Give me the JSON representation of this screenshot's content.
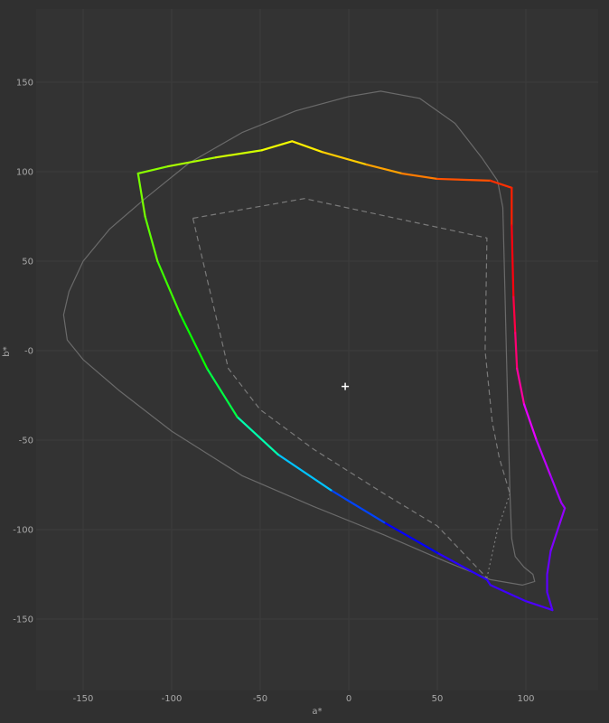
{
  "chart_data": {
    "type": "line",
    "title": "",
    "xlabel": "a*",
    "ylabel": "b*",
    "xlim": [
      -175,
      140
    ],
    "ylim": [
      -190,
      190
    ],
    "xticks": [
      -150,
      -100,
      -50,
      0,
      50,
      100
    ],
    "yticks": [
      150,
      100,
      50,
      0,
      -50,
      -100,
      -150
    ],
    "ytick_labels": [
      "150",
      "100",
      "50",
      "-0",
      "-50",
      "-100",
      "-150"
    ],
    "grid": true,
    "white_point": {
      "a": -2,
      "b": -20
    },
    "series": [
      {
        "style": "solid-gray",
        "closed": true,
        "points": [
          [
            -161,
            20
          ],
          [
            -158,
            33
          ],
          [
            -150,
            50
          ],
          [
            -135,
            68
          ],
          [
            -115,
            85
          ],
          [
            -90,
            105
          ],
          [
            -60,
            122
          ],
          [
            -30,
            134
          ],
          [
            0,
            142
          ],
          [
            18,
            145
          ],
          [
            40,
            141
          ],
          [
            60,
            127
          ],
          [
            75,
            108
          ],
          [
            84,
            95
          ],
          [
            87,
            80
          ],
          [
            88,
            40
          ],
          [
            89,
            0
          ],
          [
            90,
            -40
          ],
          [
            91,
            -80
          ],
          [
            92,
            -105
          ],
          [
            94,
            -115
          ],
          [
            99,
            -121
          ],
          [
            104,
            -125
          ],
          [
            105,
            -129
          ],
          [
            98,
            -131
          ],
          [
            80,
            -128
          ],
          [
            55,
            -118
          ],
          [
            20,
            -103
          ],
          [
            -20,
            -87
          ],
          [
            -60,
            -70
          ],
          [
            -100,
            -45
          ],
          [
            -130,
            -22
          ],
          [
            -150,
            -5
          ],
          [
            -159,
            6
          ]
        ]
      },
      {
        "style": "dashed-gray",
        "closed": false,
        "points": [
          [
            -88,
            74
          ],
          [
            -25,
            85
          ],
          [
            78,
            63
          ],
          [
            77,
            0
          ],
          [
            81,
            -40
          ],
          [
            85,
            -60
          ],
          [
            91,
            -80
          ]
        ]
      },
      {
        "style": "dashed-gray",
        "closed": false,
        "points": [
          [
            -88,
            74
          ],
          [
            -80,
            40
          ],
          [
            -68,
            -10
          ],
          [
            -50,
            -33
          ],
          [
            -20,
            -55
          ],
          [
            20,
            -80
          ],
          [
            50,
            -98
          ],
          [
            78,
            -127
          ]
        ]
      },
      {
        "style": "dotted-gray",
        "closed": false,
        "points": [
          [
            91,
            -80
          ],
          [
            84,
            -100
          ],
          [
            78,
            -127
          ]
        ]
      },
      {
        "style": "gamut",
        "closed": false,
        "points": [
          [
            -119,
            99
          ],
          [
            -102,
            103
          ],
          [
            -75,
            108
          ],
          [
            -49,
            112
          ],
          [
            -32,
            117
          ],
          [
            -15,
            111
          ],
          [
            10,
            104
          ],
          [
            30,
            99
          ],
          [
            50,
            96
          ],
          [
            80,
            95
          ],
          [
            92,
            91
          ],
          [
            92,
            70
          ],
          [
            93,
            30
          ],
          [
            94,
            10
          ],
          [
            95,
            -10
          ],
          [
            99,
            -30
          ],
          [
            106,
            -50
          ],
          [
            114,
            -70
          ],
          [
            120,
            -85
          ],
          [
            122,
            -88
          ],
          [
            119,
            -97
          ],
          [
            114,
            -112
          ],
          [
            112,
            -125
          ],
          [
            112,
            -135
          ],
          [
            115,
            -145
          ],
          [
            100,
            -140
          ],
          [
            80,
            -131
          ],
          [
            78,
            -128
          ],
          [
            50,
            -113
          ],
          [
            20,
            -96
          ],
          [
            -10,
            -78
          ],
          [
            -40,
            -58
          ],
          [
            -63,
            -37
          ],
          [
            -80,
            -10
          ],
          [
            -95,
            20
          ],
          [
            -108,
            50
          ],
          [
            -115,
            75
          ],
          [
            -119,
            99
          ]
        ]
      }
    ]
  }
}
